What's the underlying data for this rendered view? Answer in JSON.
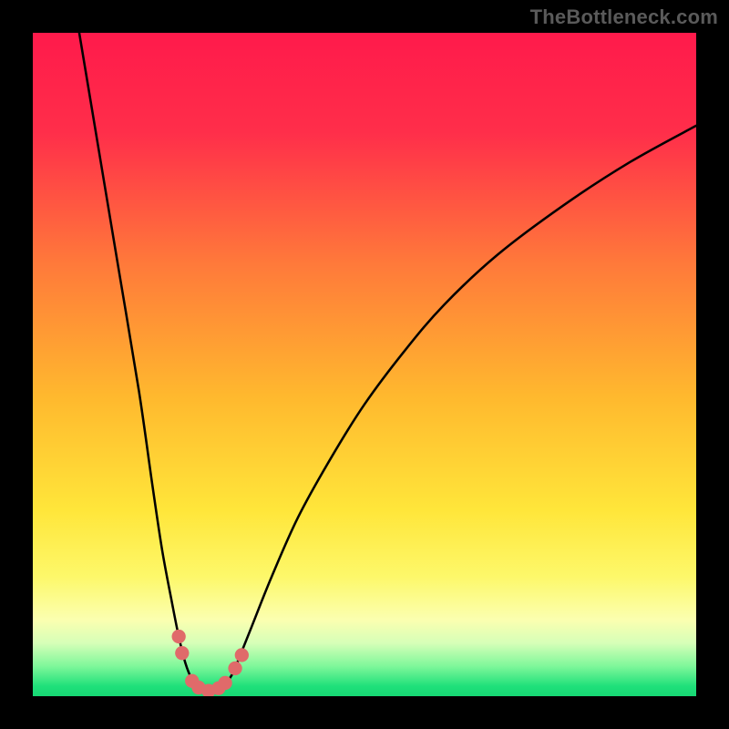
{
  "watermark": "TheBottleneck.com",
  "chart_data": {
    "type": "line",
    "title": "",
    "xlabel": "",
    "ylabel": "",
    "xlim": [
      0,
      100
    ],
    "ylim": [
      0,
      100
    ],
    "grid": false,
    "legend": false,
    "gradient_stops": [
      {
        "offset": 0.0,
        "color": "#ff1a4b"
      },
      {
        "offset": 0.15,
        "color": "#ff2e4a"
      },
      {
        "offset": 0.35,
        "color": "#ff7a3a"
      },
      {
        "offset": 0.55,
        "color": "#ffb92e"
      },
      {
        "offset": 0.72,
        "color": "#ffe63a"
      },
      {
        "offset": 0.82,
        "color": "#fdf86a"
      },
      {
        "offset": 0.885,
        "color": "#fbffb0"
      },
      {
        "offset": 0.92,
        "color": "#d6ffb8"
      },
      {
        "offset": 0.955,
        "color": "#7ef79a"
      },
      {
        "offset": 0.985,
        "color": "#1fe07a"
      },
      {
        "offset": 1.0,
        "color": "#17d874"
      }
    ],
    "series": [
      {
        "name": "bottleneck-curve",
        "stroke": "#000000",
        "x": [
          7,
          10,
          13,
          16,
          18,
          19.5,
          21,
          22,
          23,
          24,
          25,
          26,
          27,
          28,
          29,
          30,
          31,
          33,
          36,
          40,
          45,
          50,
          56,
          62,
          70,
          80,
          90,
          100
        ],
        "values": [
          100,
          82,
          64,
          46,
          32,
          22,
          14,
          9,
          5,
          2.5,
          1.2,
          0.7,
          0.7,
          1,
          1.8,
          3.2,
          5.5,
          10.5,
          18,
          27,
          36,
          44,
          52,
          59,
          66.5,
          74,
          80.5,
          86
        ]
      }
    ],
    "markers": {
      "name": "optimal-markers",
      "color": "#e06a6a",
      "points": [
        {
          "x": 22.0,
          "y": 9.0
        },
        {
          "x": 22.5,
          "y": 6.5
        },
        {
          "x": 24.0,
          "y": 2.3
        },
        {
          "x": 25.0,
          "y": 1.3
        },
        {
          "x": 26.5,
          "y": 0.8
        },
        {
          "x": 28.0,
          "y": 1.2
        },
        {
          "x": 29.0,
          "y": 2.0
        },
        {
          "x": 30.5,
          "y": 4.2
        },
        {
          "x": 31.5,
          "y": 6.2
        }
      ]
    }
  }
}
